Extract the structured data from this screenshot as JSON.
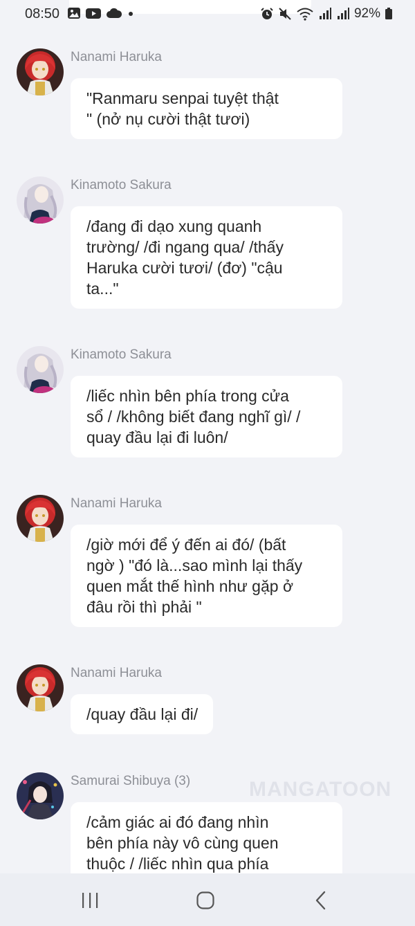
{
  "status_bar": {
    "time": "08:50",
    "battery": "92%",
    "left_icons": [
      "image-icon",
      "youtube-icon",
      "cloud-icon",
      "dot-icon"
    ],
    "right_icons": [
      "alarm-icon",
      "mute-icon",
      "wifi-icon",
      "signal-icon",
      "signal-icon",
      "battery-icon"
    ]
  },
  "messages": [
    {
      "name": "Nanami Haruka",
      "avatar": "avatar-red-hair",
      "lines": [
        "\"Ranmaru senpai tuyệt thật",
        "\" (nở nụ cười thật tươi)"
      ]
    },
    {
      "name": "Kinamoto Sakura",
      "avatar": "avatar-silver-hair",
      "lines": [
        "/đang đi dạo xung quanh",
        "trường/ /đi ngang qua/ /thấy",
        "Haruka cười tươi/ (đơ) \"cậu",
        "ta...\""
      ]
    },
    {
      "name": "Kinamoto Sakura",
      "avatar": "avatar-silver-hair",
      "lines": [
        "/liếc nhìn bên phía trong cửa",
        "sổ / /không biết đang nghĩ gì/ /",
        "quay đầu lại đi luôn/"
      ]
    },
    {
      "name": "Nanami Haruka",
      "avatar": "avatar-red-hair",
      "lines": [
        "/giờ mới để ý đến ai đó/ (bất",
        "ngờ ) \"đó là...sao mình lại thấy",
        "quen mắt thế hình như gặp ở",
        "đâu rồi thì phải \""
      ]
    },
    {
      "name": "Nanami Haruka",
      "avatar": "avatar-red-hair",
      "lines": [
        "/quay đầu lại đi/"
      ]
    },
    {
      "name": "Samurai Shibuya (3)",
      "avatar": "avatar-dark-hair",
      "lines": [
        "/cảm giác ai đó đang nhìn",
        "bên phía này vô cùng quen",
        "thuộc / /liếc nhìn qua phía"
      ]
    }
  ],
  "watermark": "MANGATOON",
  "nav": {
    "recents": "recents-icon",
    "home": "home-icon",
    "back": "back-icon"
  }
}
